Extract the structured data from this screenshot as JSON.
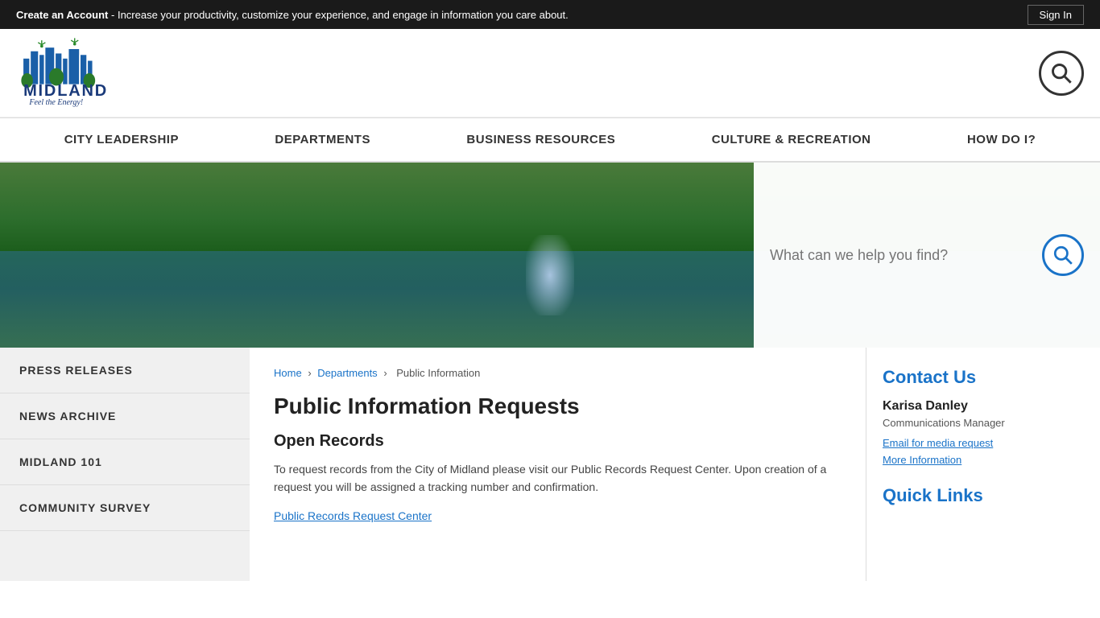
{
  "topBanner": {
    "text_prefix": "Create an Account",
    "text_bold": "Create an Account",
    "text_rest": " - Increase your productivity, customize your experience, and engage in information you care about.",
    "signInLabel": "Sign In"
  },
  "header": {
    "logoAlt": "Midland - Feel the Energy",
    "searchAriaLabel": "Search"
  },
  "nav": {
    "items": [
      {
        "label": "CITY LEADERSHIP",
        "href": "#"
      },
      {
        "label": "DEPARTMENTS",
        "href": "#"
      },
      {
        "label": "BUSINESS RESOURCES",
        "href": "#"
      },
      {
        "label": "CULTURE & RECREATION",
        "href": "#"
      },
      {
        "label": "HOW DO I?",
        "href": "#"
      }
    ]
  },
  "searchOverlay": {
    "placeholder": "What can we help you find?"
  },
  "sidebar": {
    "items": [
      {
        "label": "PRESS RELEASES"
      },
      {
        "label": "NEWS ARCHIVE"
      },
      {
        "label": "MIDLAND 101"
      },
      {
        "label": "COMMUNITY SURVEY"
      }
    ]
  },
  "breadcrumb": {
    "home": "Home",
    "departments": "Departments",
    "current": "Public Information"
  },
  "mainContent": {
    "pageTitle": "Public Information Requests",
    "sectionTitle": "Open Records",
    "bodyText": "To request records from the City of Midland please visit our Public Records Request Center. Upon creation of a request you will be assigned a tracking number and confirmation.",
    "linkLabel": "Public Records Request Center"
  },
  "rightSidebar": {
    "contactTitle": "Contact Us",
    "contactName": "Karisa Danley",
    "contactRole": "Communications Manager",
    "emailLinkLabel": "Email for media request",
    "moreLinkLabel": "More Information",
    "quickLinksTitle": "Quick Links"
  }
}
